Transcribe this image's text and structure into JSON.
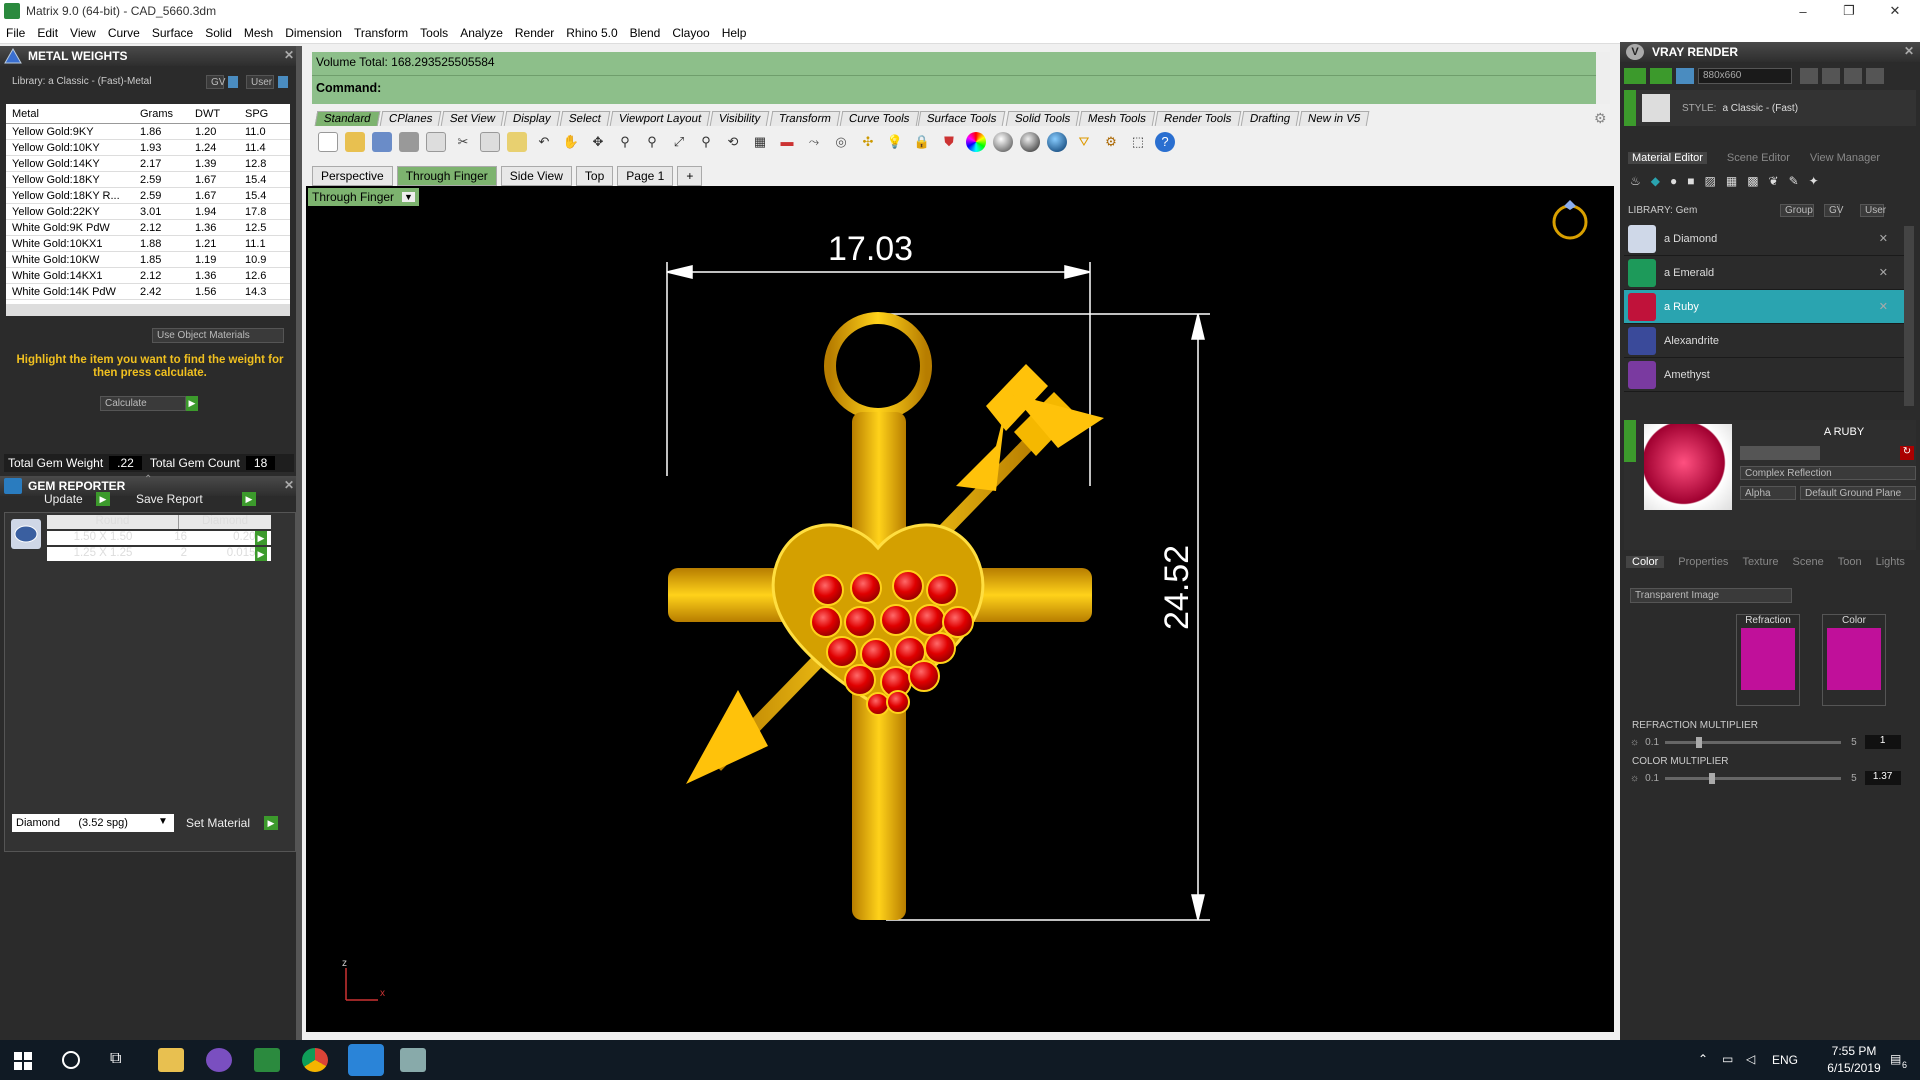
{
  "window": {
    "title": "Matrix 9.0 (64-bit) - CAD_5660.3dm",
    "minimize": "–",
    "restore": "❐",
    "close": "✕"
  },
  "menu": [
    "File",
    "Edit",
    "View",
    "Curve",
    "Surface",
    "Solid",
    "Mesh",
    "Dimension",
    "Transform",
    "Tools",
    "Analyze",
    "Render",
    "Rhino 5.0",
    "Blend",
    "Clayoo",
    "Help"
  ],
  "metal_weights": {
    "title": "METAL WEIGHTS",
    "library": "Library: a Classic - (Fast)-Metal",
    "gv": "GV",
    "user": "User",
    "columns": [
      "Metal",
      "Grams",
      "DWT",
      "SPG"
    ],
    "rows": [
      [
        "Yellow Gold:9KY",
        "1.86",
        "1.20",
        "11.0"
      ],
      [
        "Yellow Gold:10KY",
        "1.93",
        "1.24",
        "11.4"
      ],
      [
        "Yellow Gold:14KY",
        "2.17",
        "1.39",
        "12.8"
      ],
      [
        "Yellow Gold:18KY",
        "2.59",
        "1.67",
        "15.4"
      ],
      [
        "Yellow Gold:18KY R...",
        "2.59",
        "1.67",
        "15.4"
      ],
      [
        "Yellow Gold:22KY",
        "3.01",
        "1.94",
        "17.8"
      ],
      [
        "White Gold:9K PdW",
        "2.12",
        "1.36",
        "12.5"
      ],
      [
        "White Gold:10KX1",
        "1.88",
        "1.21",
        "11.1"
      ],
      [
        "White Gold:10KW",
        "1.85",
        "1.19",
        "10.9"
      ],
      [
        "White Gold:14KX1",
        "2.12",
        "1.36",
        "12.6"
      ],
      [
        "White Gold:14K PdW",
        "2.42",
        "1.56",
        "14.3"
      ]
    ],
    "use_object_materials": "Use Object Materials",
    "hint": "Highlight the item you want to find the weight for then press calculate.",
    "calculate": "Calculate"
  },
  "gem_reporter": {
    "title": "GEM REPORTER",
    "total_weight_label": "Total Gem Weight",
    "total_weight": ".22",
    "total_count_label": "Total Gem Count",
    "total_count": "18",
    "update": "Update",
    "save_report": "Save Report",
    "columns": [
      "Round",
      "Diamond"
    ],
    "rows": [
      [
        "1.50 X 1.50",
        "16",
        "0.20tw"
      ],
      [
        "1.25 X 1.25",
        "2",
        "0.015tw"
      ]
    ],
    "material_select": "Diamond      (3.52 spg)",
    "set_material": "Set Material"
  },
  "command": {
    "volume": "Volume Total: 168.293525505584",
    "prompt": "Command:"
  },
  "toolbar_tabs": [
    "Standard",
    "CPlanes",
    "Set View",
    "Display",
    "Select",
    "Viewport Layout",
    "Visibility",
    "Transform",
    "Curve Tools",
    "Surface Tools",
    "Solid Tools",
    "Mesh Tools",
    "Render Tools",
    "Drafting",
    "New in V5"
  ],
  "view_tabs": [
    "Perspective",
    "Through Finger",
    "Side View",
    "Top",
    "Page 1",
    "+"
  ],
  "viewport": {
    "label": "Through Finger",
    "dim_width": "17.03",
    "dim_height": "24.52",
    "axis_z": "z",
    "axis_x": "x"
  },
  "vray": {
    "title": "VRAY RENDER",
    "resolution": "880x660",
    "style_label": "STYLE:",
    "style_value": "a Classic - (Fast)",
    "tabs": [
      "Material Editor",
      "Scene Editor",
      "View Manager"
    ],
    "library_label": "LIBRARY: Gem",
    "group": "Group",
    "gv": "GV",
    "user": "User",
    "items": [
      "a Diamond",
      "a Emerald",
      "a Ruby",
      "Alexandrite",
      "Amethyst"
    ],
    "selected_name": "A RUBY",
    "reflection": "Complex Reflection",
    "alpha": "Alpha",
    "ground": "Default Ground Plane",
    "prop_tabs": [
      "Color",
      "Properties",
      "Texture",
      "Scene",
      "Toon",
      "Lights"
    ],
    "transparent": "Transparent Image",
    "refraction": "Refraction",
    "color": "Color",
    "refr_mult_label": "REFRACTION MULTIPLIER",
    "refr_min": "0.1",
    "refr_max": "5",
    "refr_val": "1",
    "color_mult_label": "COLOR MULTIPLIER",
    "color_min": "0.1",
    "color_max": "5",
    "color_val": "1.37"
  },
  "taskbar": {
    "lang": "ENG",
    "time": "7:55 PM",
    "date": "6/15/2019",
    "notif": "6"
  }
}
